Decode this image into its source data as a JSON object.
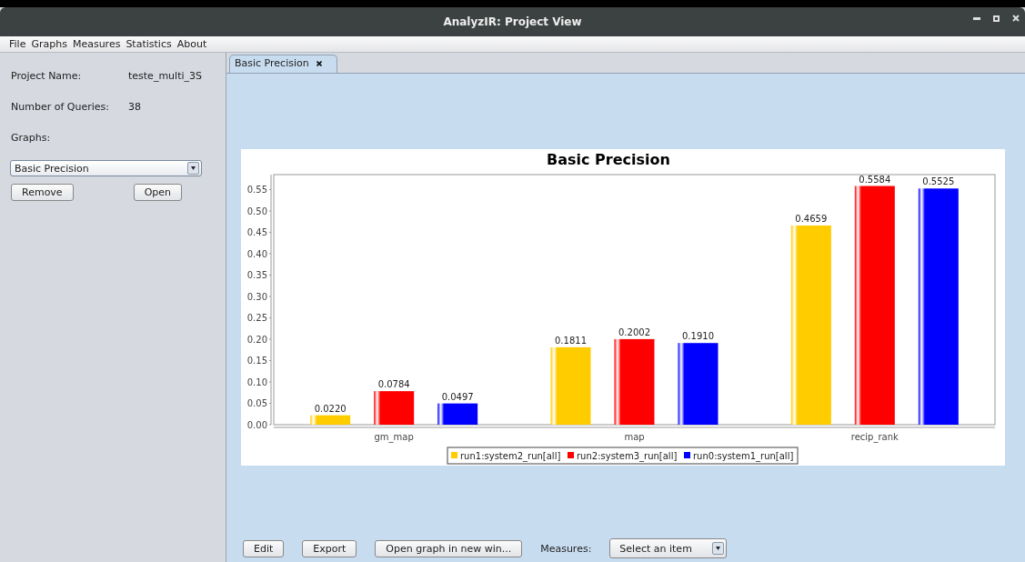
{
  "window": {
    "title": "AnalyzIR: Project View"
  },
  "menu": [
    "File",
    "Graphs",
    "Measures",
    "Statistics",
    "About"
  ],
  "sidebar": {
    "fields": [
      {
        "label": "Project Name:",
        "value": "teste_multi_3S"
      },
      {
        "label": "Number of Queries:",
        "value": "38"
      }
    ],
    "graphs_label": "Graphs:",
    "graphs_select": {
      "value": "Basic Precision"
    },
    "buttons": [
      "Remove",
      "Open"
    ]
  },
  "tabs": [
    {
      "label": "Basic Precision",
      "selected": true,
      "closable": true
    }
  ],
  "chart": {
    "chart_data": {
      "type": "bar",
      "title": "Basic Precision",
      "categories": [
        "gm_map",
        "map",
        "recip_rank"
      ],
      "series": [
        {
          "name": "run1:system2_run[all]",
          "color": "#ffcc00",
          "values": [
            0.022,
            0.1811,
            0.4659
          ]
        },
        {
          "name": "run2:system3_run[all]",
          "color": "#ff0000",
          "values": [
            0.0784,
            0.2002,
            0.5584
          ]
        },
        {
          "name": "run0:system1_run[all]",
          "color": "#0000ff",
          "values": [
            0.0497,
            0.191,
            0.5525
          ]
        }
      ],
      "ylim": [
        0,
        0.585
      ],
      "legend": "bottom",
      "yticks": [
        {
          "value": 0,
          "label": "0.00"
        },
        {
          "value": 0.05,
          "label": "0.05"
        },
        {
          "value": 0.1,
          "label": "0.10"
        },
        {
          "value": 0.15,
          "label": "0.15"
        },
        {
          "value": 0.2,
          "label": "0.20"
        },
        {
          "value": 0.25,
          "label": "0.25"
        },
        {
          "value": 0.3,
          "label": "0.30"
        },
        {
          "value": 0.35,
          "label": "0.35"
        },
        {
          "value": 0.4,
          "label": "0.40"
        },
        {
          "value": 0.45,
          "label": "0.45"
        },
        {
          "value": 0.5,
          "label": "0.50"
        },
        {
          "value": 0.55,
          "label": "0.55"
        }
      ],
      "value_labels": [
        [
          "0.0220",
          "0.1811",
          "0.4659"
        ],
        [
          "0.0784",
          "0.2002",
          "0.5584"
        ],
        [
          "0.0497",
          "0.1910",
          "0.5525"
        ]
      ]
    }
  },
  "bottom_bar": [
    {
      "kind": "button",
      "label": "Edit"
    },
    {
      "kind": "button",
      "label": "Export"
    },
    {
      "kind": "button",
      "label": "Open graph in new win..."
    },
    {
      "kind": "label",
      "label": "Measures:"
    },
    {
      "kind": "select",
      "label": "Select an item"
    }
  ]
}
